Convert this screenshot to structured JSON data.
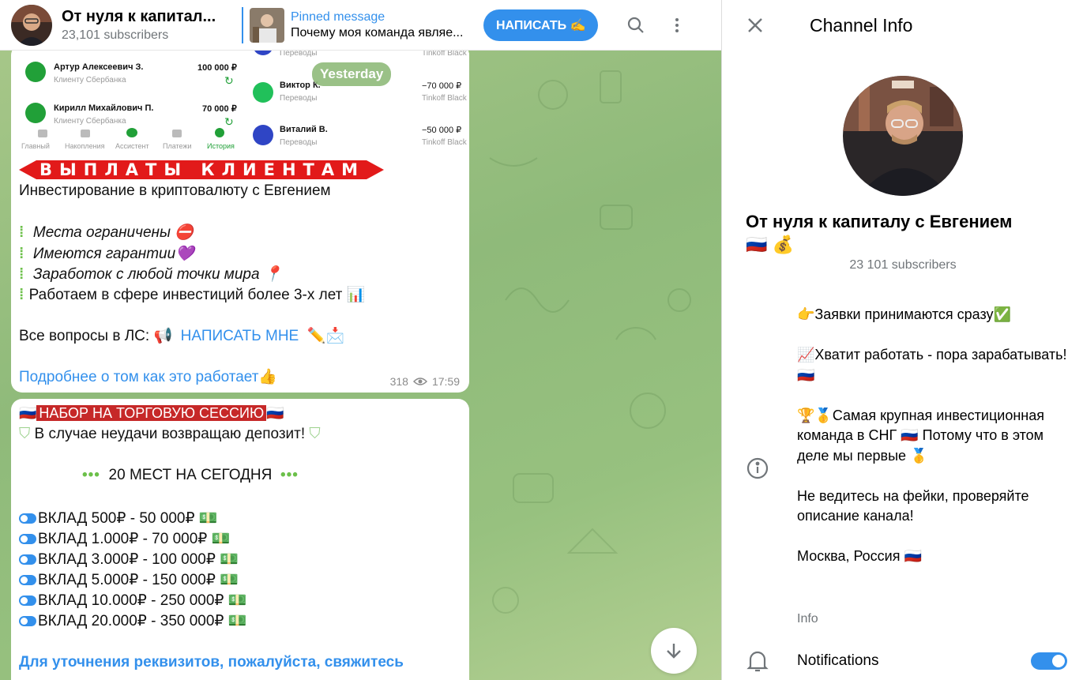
{
  "header": {
    "channel_name": "От нуля к капитал...",
    "subscribers": "23,101 subscribers",
    "pinned_title": "Pinned message",
    "pinned_text": "Почему моя команда являе...",
    "write_button": "НАПИСАТЬ ✍️"
  },
  "date_pill": "Yesterday",
  "screenshot": {
    "left_rows": [
      {
        "name": "Артур Алексеевич З.",
        "sub": "Клиенту Сбербанка",
        "amount": "100 000 ₽"
      },
      {
        "name": "Кирилл Михайлович П.",
        "sub": "Клиенту Сбербанка",
        "amount": "70 000 ₽"
      }
    ],
    "nav": [
      "Главный",
      "Накопления",
      "Ассистент",
      "Платежи",
      "История"
    ],
    "right_rows": [
      {
        "name": "",
        "sub": "Переводы",
        "amount": "",
        "bank": "Tinkoff Black"
      },
      {
        "name": "Виктор К.",
        "sub": "Переводы",
        "amount": "−70 000 ₽",
        "bank": "Tinkoff Black"
      },
      {
        "name": "Виталий В.",
        "sub": "Переводы",
        "amount": "−50 000 ₽",
        "bank": "Tinkoff Black"
      }
    ]
  },
  "post1": {
    "banner": "ВЫПЛАТЫ КЛИЕНТАМ",
    "intro": "Инвестирование в криптовалюту с Евгением",
    "bullets": [
      "Места ограничены ⛔",
      "Имеются гарантии💜",
      "Заработок с любой точки мира 📍",
      "Работаем в сфере инвестиций более 3-х лет 📊"
    ],
    "questions": "Все вопросы в ЛС: 📢",
    "write_link": "НАПИСАТЬ МНЕ",
    "write_emoji": "✏️📩",
    "more_link": "Подробнее о том как это работает",
    "more_emoji": "👍",
    "views": "318",
    "time": "17:59"
  },
  "post2": {
    "title": "НАБОР НА ТОРГОВУЮ СЕССИЮ",
    "flag": "🇷🇺",
    "guarantee": "В случае неудачи возвращаю депозит!",
    "places": "20 МЕСТ НА СЕГОДНЯ",
    "deposits": [
      "ВКЛАД 500₽ - 50 000₽",
      "ВКЛАД 1.000₽ - 70 000₽",
      "ВКЛАД 3.000₽ - 100 000₽",
      "ВКЛАД 5.000₽ - 150 000₽",
      "ВКЛАД 10.000₽ - 250 000₽",
      "ВКЛАД 20.000₽ - 350 000₽"
    ],
    "contact": "Для уточнения реквизитов, пожалуйста, свяжитесь"
  },
  "info_panel": {
    "title": "Channel Info",
    "channel_name": "От нуля к капиталу с Евгением",
    "channel_emoji": "🇷🇺 💰",
    "subscribers": "23 101 subscribers",
    "description": [
      "👉Заявки принимаются сразу✅",
      "📈Хватит работать - пора зарабатывать!🇷🇺",
      "🏆🥇Самая крупная инвестиционная команда в СНГ 🇷🇺 Потому что в этом деле мы первые 🥇",
      "Не ведитесь на фейки, проверяйте описание канала!",
      "Москва, Россия 🇷🇺"
    ],
    "info_label": "Info",
    "notifications_label": "Notifications",
    "notifications_on": true
  },
  "colors": {
    "accent": "#3390ec",
    "chat_bg": "#9cc483",
    "banner_red": "#e21a1a",
    "green_check": "#21a038"
  },
  "icons": [
    "search-icon",
    "more-vertical-icon",
    "close-icon",
    "info-icon",
    "bell-icon",
    "eye-icon",
    "chevron-down-icon"
  ]
}
